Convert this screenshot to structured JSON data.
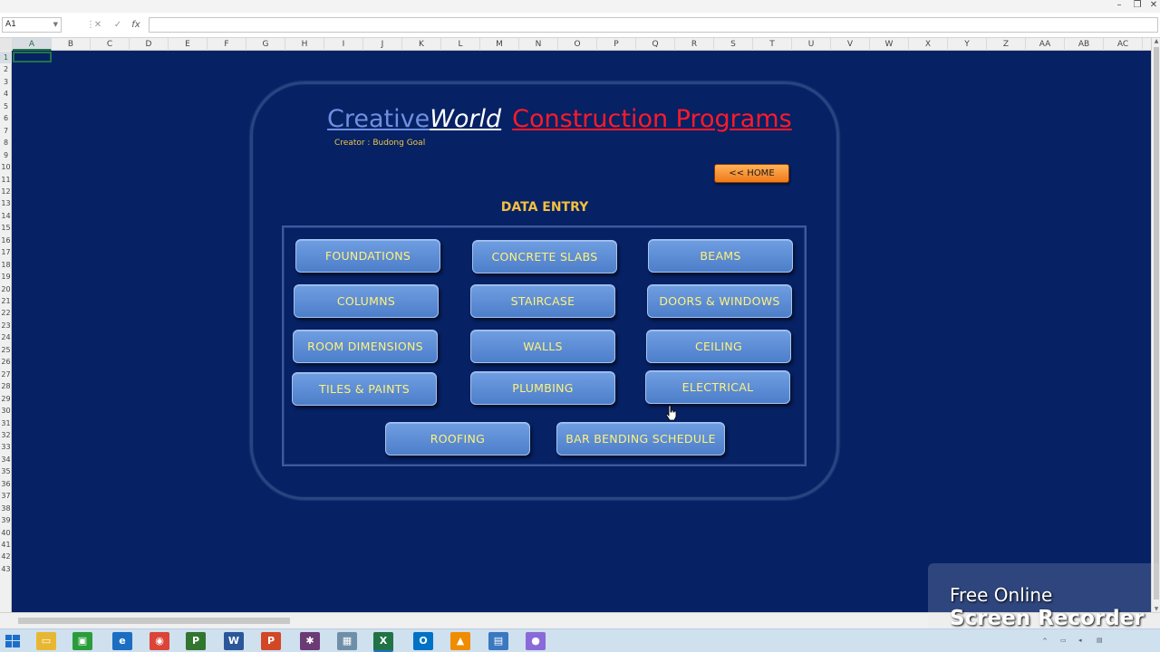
{
  "window": {
    "minimize": "–",
    "restore": "❐",
    "close": "✕"
  },
  "formula_bar": {
    "name_box": "A1",
    "cancel_icon": "✕",
    "enter_icon": "✓",
    "fx_label": "fx"
  },
  "columns": [
    "A",
    "B",
    "C",
    "D",
    "E",
    "F",
    "G",
    "H",
    "I",
    "J",
    "K",
    "L",
    "M",
    "N",
    "O",
    "P",
    "Q",
    "R",
    "S",
    "T",
    "U",
    "V",
    "W",
    "X",
    "Y",
    "Z",
    "AA",
    "AB",
    "AC"
  ],
  "rows": [
    "1",
    "2",
    "3",
    "4",
    "5",
    "6",
    "7",
    "8",
    "9",
    "10",
    "11",
    "12",
    "13",
    "14",
    "15",
    "16",
    "17",
    "18",
    "19",
    "20",
    "21",
    "22",
    "23",
    "24",
    "25",
    "26",
    "27",
    "28",
    "29",
    "30",
    "31",
    "32",
    "33",
    "34",
    "35",
    "36",
    "37",
    "38",
    "39",
    "40",
    "41",
    "42",
    "43"
  ],
  "panel": {
    "title_part1": "Creative",
    "title_part2": "World",
    "title_part3": "Construction Programs",
    "creator": "Creator  :  Budong Goal",
    "home_button": "<< HOME",
    "section_title": "DATA ENTRY",
    "buttons": {
      "foundations": "FOUNDATIONS",
      "concrete_slabs": "CONCRETE SLABS",
      "beams": "BEAMS",
      "columns": "COLUMNS",
      "staircase": "STAIRCASE",
      "doors_windows": "DOORS & WINDOWS",
      "room_dimensions": "ROOM DIMENSIONS",
      "walls": "WALLS",
      "ceiling": "CEILING",
      "tiles_paints": "TILES & PAINTS",
      "plumbing": "PLUMBING",
      "electrical": "ELECTRICAL",
      "roofing": "ROOFING",
      "bar_bending_schedule": "BAR BENDING SCHEDULE"
    }
  },
  "recorder": {
    "line1": "Free Online",
    "line2": "Screen Recorder"
  },
  "taskbar": {
    "apps": [
      {
        "name": "file-explorer",
        "glyph": "▭",
        "color": "#e8b732"
      },
      {
        "name": "store",
        "glyph": "▣",
        "color": "#2a9d3a"
      },
      {
        "name": "edge",
        "glyph": "e",
        "color": "#1b6ec2"
      },
      {
        "name": "chrome",
        "glyph": "◉",
        "color": "#db4437"
      },
      {
        "name": "project",
        "glyph": "P",
        "color": "#31752f"
      },
      {
        "name": "word",
        "glyph": "W",
        "color": "#2b579a"
      },
      {
        "name": "powerpoint",
        "glyph": "P",
        "color": "#d24726"
      },
      {
        "name": "slack",
        "glyph": "✱",
        "color": "#6b3b76"
      },
      {
        "name": "calculator",
        "glyph": "▦",
        "color": "#6f8fa8"
      },
      {
        "name": "excel",
        "glyph": "X",
        "color": "#217346"
      },
      {
        "name": "outlook",
        "glyph": "O",
        "color": "#0072c6"
      },
      {
        "name": "vlc",
        "glyph": "▲",
        "color": "#f08c00"
      },
      {
        "name": "photos",
        "glyph": "▤",
        "color": "#3a78c0"
      },
      {
        "name": "recorder-app",
        "glyph": "●",
        "color": "#8a6ad8"
      }
    ]
  },
  "colors": {
    "sheet_background": "#062164",
    "button_fill": "#5b8bd4",
    "button_text": "#fff27a",
    "home_button": "#f58a22",
    "section_title": "#f4c040",
    "title_red": "#ff1a2a",
    "title_blue": "#6f8fe0"
  }
}
